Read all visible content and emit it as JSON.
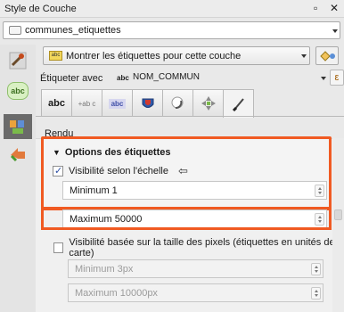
{
  "window": {
    "title": "Style de Couche"
  },
  "layer": {
    "name": "communes_etiquettes"
  },
  "labeling": {
    "mode": "Montrer les étiquettes pour cette couche",
    "label_with": "Étiqueter avec",
    "field_prefix": "abc",
    "field": "NOM_COMMUN",
    "expression_symbol": "ε"
  },
  "tabs": [
    {
      "label": "abc"
    },
    {
      "label": "+ab c"
    },
    {
      "label": "abc"
    },
    {
      "label": ""
    },
    {
      "label": ""
    },
    {
      "label": ""
    },
    {
      "label": ""
    }
  ],
  "rendu": {
    "title": "Rendu"
  },
  "options": {
    "header": "Options des étiquettes",
    "scale_visibility": {
      "label": "Visibilité selon l'échelle",
      "checked": true
    },
    "minimum": "Minimum 1",
    "maximum": "Maximum 50000",
    "pixel_visibility": {
      "label": "Visibilité basée sur la taille des pixels (étiquettes en unités de carte)",
      "checked": false
    },
    "min_px": "Minimum 3px",
    "max_px": "Maximum 10000px"
  },
  "colors": {
    "highlight": "#f05a22",
    "accent": "#2d4fa3"
  },
  "icons": [
    "list-icon",
    "paint-icon",
    "labels-icon",
    "layers-icon",
    "arrow-icon",
    "expression-icon"
  ]
}
